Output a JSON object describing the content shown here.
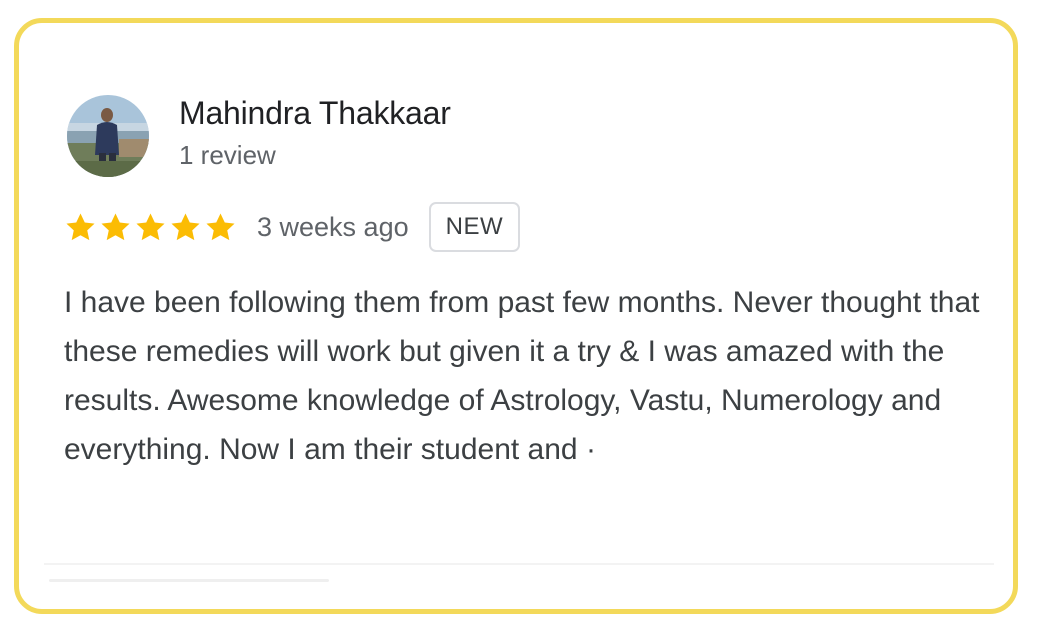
{
  "reviewer": {
    "name": "Mahindra Thakkaar",
    "review_count": "1 review",
    "avatar_icon": "profile-photo"
  },
  "review": {
    "rating": 5,
    "rating_max": 5,
    "star_color": "#fbbc04",
    "date": "3 weeks ago",
    "badge": "NEW",
    "text": "I have been following them from past few months. Never thought that these remedies will work but given it a try & I was amazed with the results. Awesome knowledge of Astrology, Vastu, Numerology and everything. Now I am their student and ·"
  },
  "colors": {
    "border": "#f3d95a",
    "text_primary": "#202124",
    "text_secondary": "#5f6368"
  }
}
